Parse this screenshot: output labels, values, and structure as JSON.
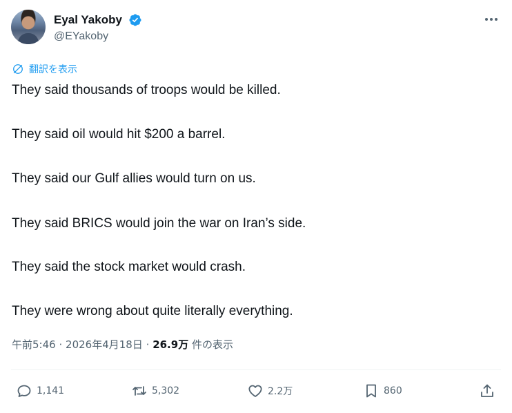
{
  "author": {
    "name": "Eyal Yakoby",
    "handle": "@EYakoby"
  },
  "translate_label": "翻訳を表示",
  "tweet_lines": [
    "They said thousands of troops would be killed.",
    "They said oil would hit $200 a barrel.",
    "They said our Gulf allies would turn on us.",
    "They said BRICS would join the war on Iran’s side.",
    "They said the stock market would crash.",
    "They were wrong about quite literally everything."
  ],
  "meta": {
    "time": "午前5:46",
    "separator": "·",
    "date": "2026年4月18日",
    "views_count": "26.9万",
    "views_label": "件の表示"
  },
  "actions": {
    "replies": "1,141",
    "reposts": "5,302",
    "likes": "2.2万",
    "bookmarks": "860"
  },
  "icons": [
    "verified-badge-icon",
    "more-icon",
    "translate-icon",
    "reply-icon",
    "repost-icon",
    "like-icon",
    "bookmark-icon",
    "share-icon"
  ],
  "colors": {
    "accent": "#1d9bf0",
    "text": "#0f1419",
    "secondary": "#536471",
    "divider": "#eff3f4"
  }
}
